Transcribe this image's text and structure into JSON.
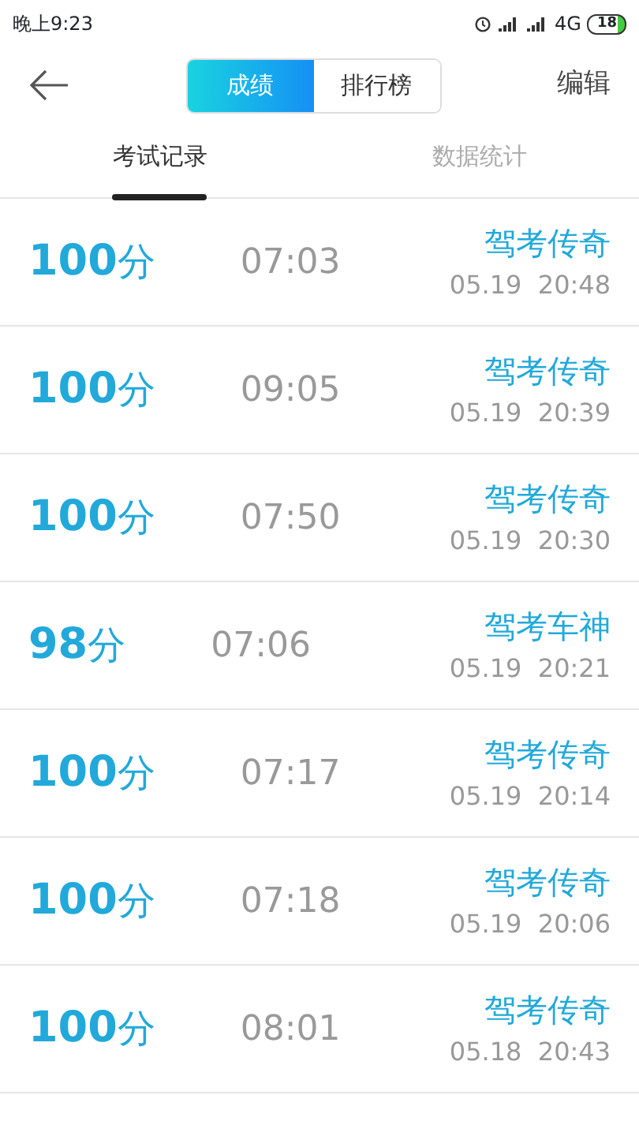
{
  "status_bar": {
    "time": "晚上9:23",
    "network": "4G",
    "battery": "18"
  },
  "header": {
    "segments": [
      {
        "label": "成绩",
        "selected": true
      },
      {
        "label": "排行榜",
        "selected": false
      }
    ],
    "action": "编辑"
  },
  "tabs": [
    {
      "label": "考试记录",
      "selected": true
    },
    {
      "label": "数据统计",
      "selected": false
    }
  ],
  "records": [
    {
      "score": "100",
      "unit": "分",
      "duration": "07:03",
      "title": "驾考传奇",
      "date": "05.19",
      "time": "20:48"
    },
    {
      "score": "100",
      "unit": "分",
      "duration": "09:05",
      "title": "驾考传奇",
      "date": "05.19",
      "time": "20:39"
    },
    {
      "score": "100",
      "unit": "分",
      "duration": "07:50",
      "title": "驾考传奇",
      "date": "05.19",
      "time": "20:30"
    },
    {
      "score": "98",
      "unit": "分",
      "duration": "07:06",
      "title": "驾考车神",
      "date": "05.19",
      "time": "20:21"
    },
    {
      "score": "100",
      "unit": "分",
      "duration": "07:17",
      "title": "驾考传奇",
      "date": "05.19",
      "time": "20:14"
    },
    {
      "score": "100",
      "unit": "分",
      "duration": "07:18",
      "title": "驾考传奇",
      "date": "05.19",
      "time": "20:06"
    },
    {
      "score": "100",
      "unit": "分",
      "duration": "08:01",
      "title": "驾考传奇",
      "date": "05.18",
      "time": "20:43"
    }
  ]
}
